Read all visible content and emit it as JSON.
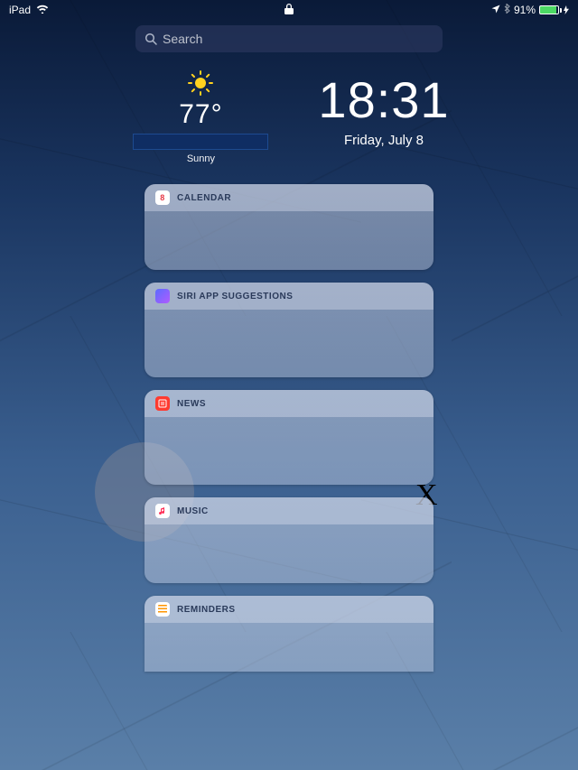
{
  "status": {
    "device": "iPad",
    "battery_pct": "91%"
  },
  "search": {
    "placeholder": "Search"
  },
  "weather": {
    "temp": "77°",
    "condition": "Sunny"
  },
  "clock": {
    "time": "18:31",
    "date": "Friday, July 8"
  },
  "widgets": [
    {
      "title": "CALENDAR",
      "icon": "calendar",
      "day": "8"
    },
    {
      "title": "SIRI APP SUGGESTIONS",
      "icon": "siri"
    },
    {
      "title": "NEWS",
      "icon": "news"
    },
    {
      "title": "MUSIC",
      "icon": "music"
    },
    {
      "title": "REMINDERS",
      "icon": "reminders"
    }
  ],
  "bg_mark": "X"
}
